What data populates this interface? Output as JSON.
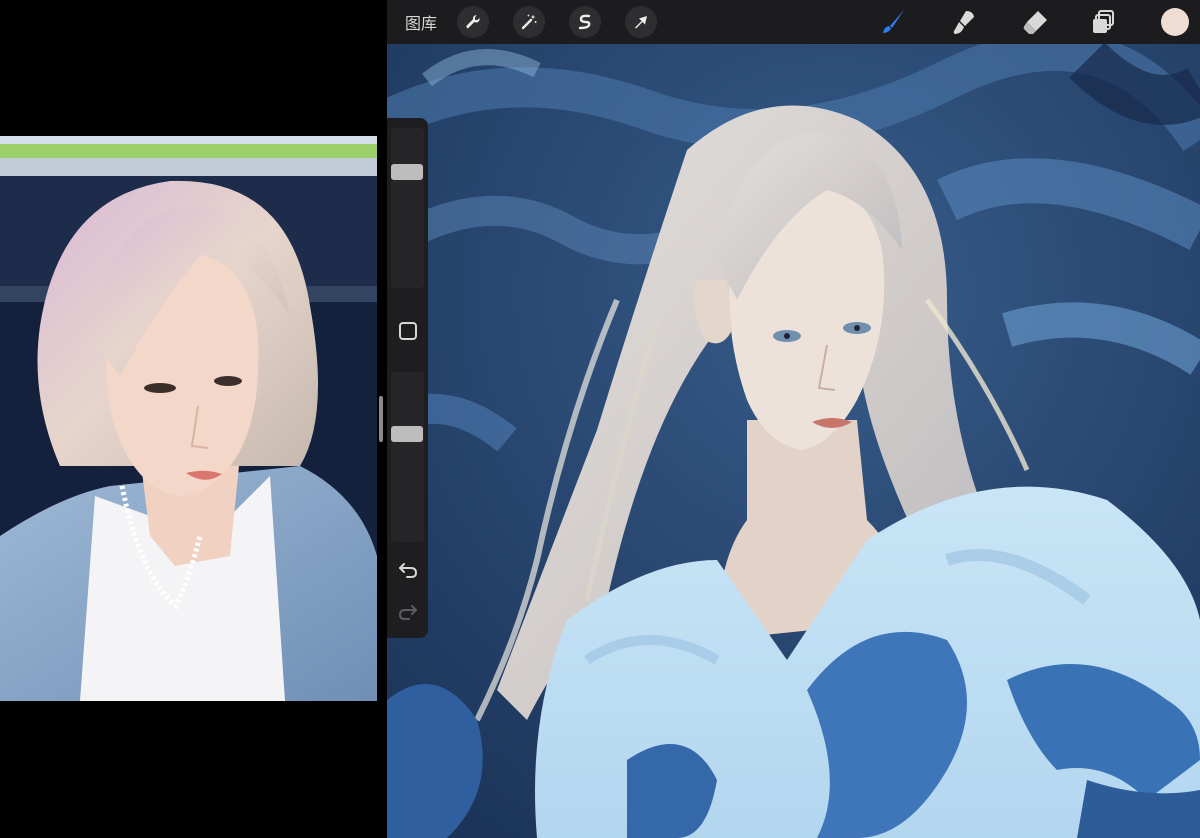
{
  "toolbar": {
    "gallery_label": "图库",
    "left_tools": [
      "wrench-icon",
      "magic-wand-icon",
      "selection-icon",
      "transform-arrow-icon"
    ],
    "right_tools": [
      "brush-icon",
      "smudge-icon",
      "eraser-icon",
      "layers-icon"
    ],
    "active_tool": "brush-icon",
    "accent_color": "#2f7cf6",
    "current_color": "#efdcd2"
  },
  "sidebar": {
    "brush_size_level": 0.25,
    "opacity_level": 0.35,
    "buttons": [
      "modify-square-icon",
      "undo-icon",
      "redo-icon"
    ]
  },
  "reference_panel": {
    "content": "reference photo"
  }
}
